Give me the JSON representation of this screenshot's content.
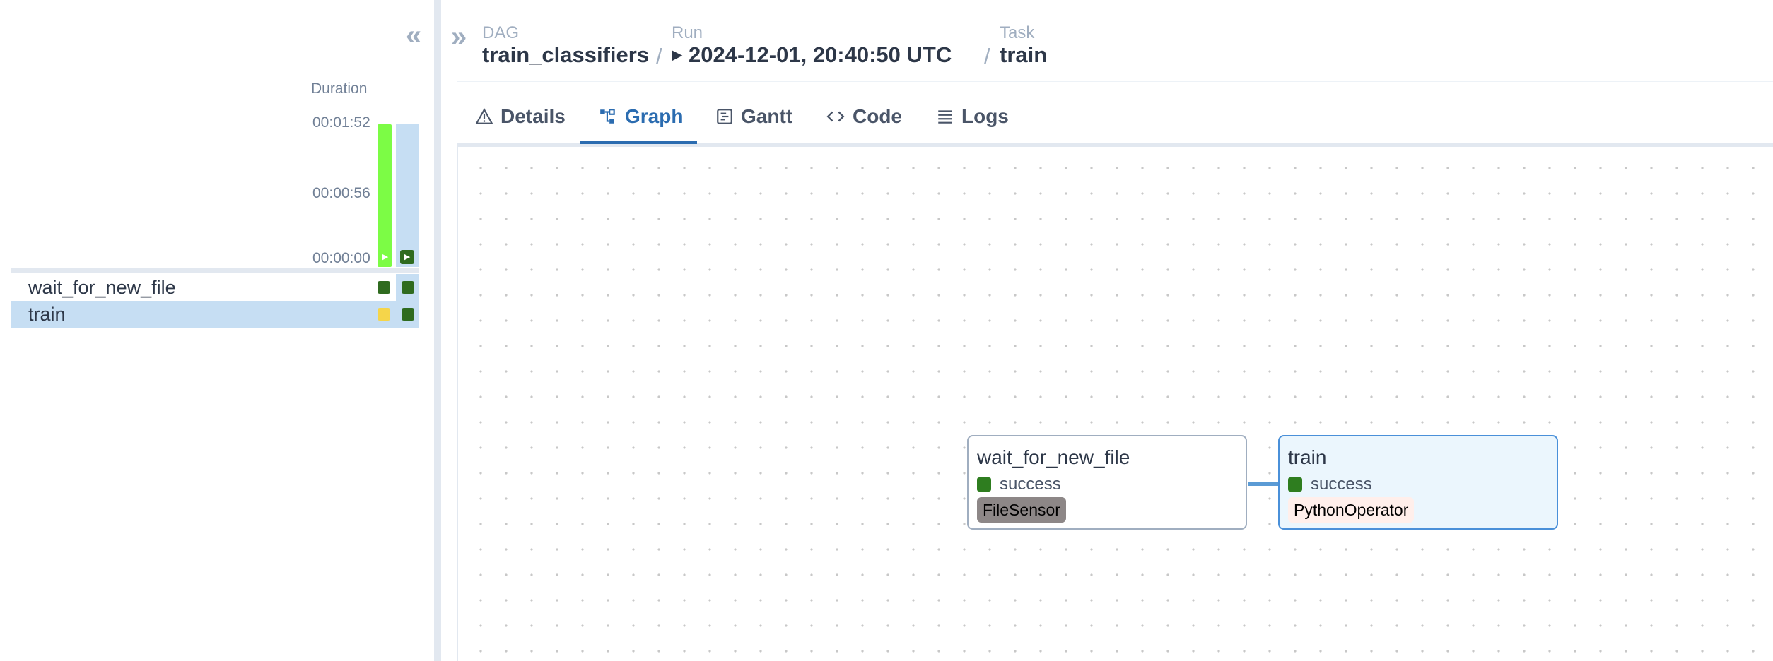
{
  "grid": {
    "collapse_icon": "«",
    "duration_label": "Duration",
    "ticks": [
      "00:01:52",
      "00:00:56",
      "00:00:00"
    ],
    "tasks": [
      {
        "name": "wait_for_new_file",
        "cells": [
          "#2f6b1f",
          "#2f6b1f"
        ],
        "selected": false
      },
      {
        "name": "train",
        "cells": [
          "#f5d54a",
          "#2f6b1f"
        ],
        "selected": true
      }
    ],
    "colors": {
      "selected_run": "#7cfc45",
      "success": "#2f6b1f",
      "queued": "#f5d54a",
      "highlight": "#c6def3"
    }
  },
  "header": {
    "expand_icon": "»",
    "breadcrumbs": [
      {
        "label": "DAG",
        "value": "train_classifiers"
      },
      {
        "label": "Run",
        "value": "2024-12-01, 20:40:50 UTC"
      },
      {
        "label": "Task",
        "value": "train"
      }
    ],
    "separator": "/"
  },
  "tabs": [
    {
      "label": "Details",
      "icon": "warning-triangle-icon"
    },
    {
      "label": "Graph",
      "icon": "graph-icon",
      "active": true
    },
    {
      "label": "Gantt",
      "icon": "gantt-icon"
    },
    {
      "label": "Code",
      "icon": "code-icon"
    },
    {
      "label": "Logs",
      "icon": "list-icon"
    }
  ],
  "graph": {
    "nodes": [
      {
        "title": "wait_for_new_file",
        "state": "success",
        "operator": "FileSensor",
        "operator_color": "#8d8787",
        "selected": false
      },
      {
        "title": "train",
        "state": "success",
        "operator": "PythonOperator",
        "operator_color": "#ffefeb",
        "selected": true
      }
    ],
    "state_color": "#2e7d1f",
    "edge_color": "#5b9bd5"
  }
}
